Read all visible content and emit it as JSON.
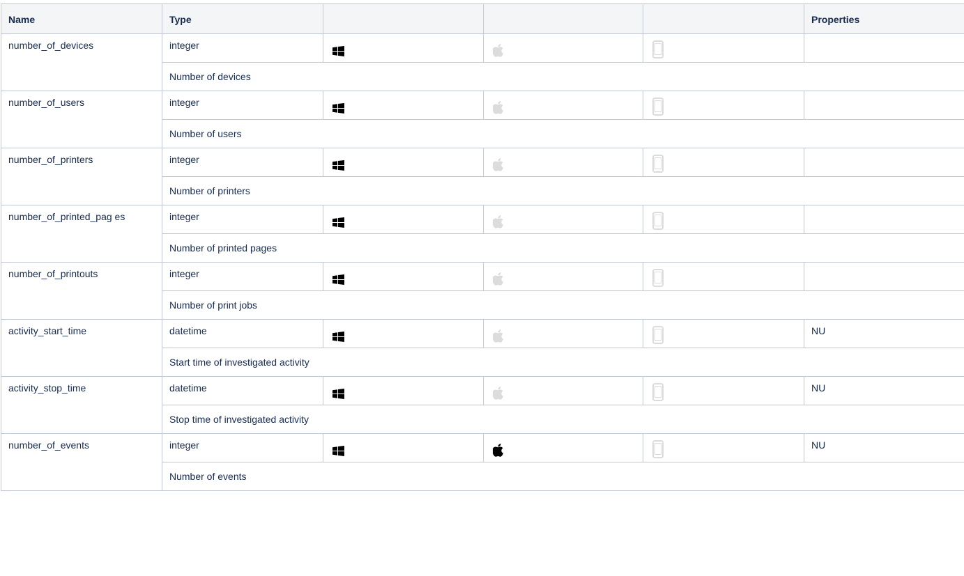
{
  "header": {
    "name": "Name",
    "type": "Type",
    "windows": "",
    "mac": "",
    "mobile": "",
    "properties": "Properties"
  },
  "rows": [
    {
      "name": "number_of_devices",
      "type": "integer",
      "windows": true,
      "mac": false,
      "mobile": false,
      "properties": "",
      "description": "Number of devices"
    },
    {
      "name": "number_of_users",
      "type": "integer",
      "windows": true,
      "mac": false,
      "mobile": false,
      "properties": "",
      "description": "Number of users"
    },
    {
      "name": "number_of_printers",
      "type": "integer",
      "windows": true,
      "mac": false,
      "mobile": false,
      "properties": "",
      "description": "Number of printers"
    },
    {
      "name": "number_of_printed_pag es",
      "type": "integer",
      "windows": true,
      "mac": false,
      "mobile": false,
      "properties": "",
      "description": "Number of printed pages"
    },
    {
      "name": "number_of_printouts",
      "type": "integer",
      "windows": true,
      "mac": false,
      "mobile": false,
      "properties": "",
      "description": "Number of print jobs"
    },
    {
      "name": "activity_start_time",
      "type": "datetime",
      "windows": true,
      "mac": false,
      "mobile": false,
      "properties": "NU",
      "description": "Start time of investigated activity"
    },
    {
      "name": "activity_stop_time",
      "type": "datetime",
      "windows": true,
      "mac": false,
      "mobile": false,
      "properties": "NU",
      "description": "Stop time of investigated activity"
    },
    {
      "name": "number_of_events",
      "type": "integer",
      "windows": true,
      "mac": true,
      "mobile": false,
      "properties": "NU",
      "description": "Number of events"
    }
  ],
  "icons": {
    "windows": "windows-icon",
    "mac": "apple-icon",
    "mobile": "mobile-device-icon"
  },
  "colors": {
    "active": "#000000",
    "inactive": "#dcdcdc",
    "header_bg": "#f4f5f7",
    "border": "#c1c7d0"
  }
}
